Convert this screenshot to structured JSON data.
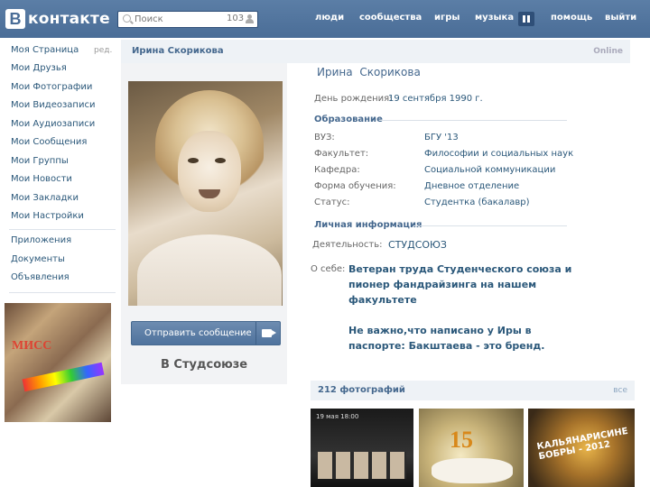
{
  "header": {
    "logo_letter": "В",
    "logo_text": "контакте",
    "search": {
      "placeholder": "Поиск",
      "count": "103"
    },
    "nav": [
      "люди",
      "сообщества",
      "игры",
      "музыка",
      "помощь",
      "выйти"
    ]
  },
  "sidebar": {
    "edit_label": "ред.",
    "items": [
      "Моя Страница",
      "Мои Друзья",
      "Мои Фотографии",
      "Мои Видеозаписи",
      "Мои Аудиозаписи",
      "Мои Сообщения",
      "Мои Группы",
      "Мои Новости",
      "Мои Закладки",
      "Мои Настройки"
    ],
    "apps": [
      "Приложения",
      "Документы",
      "Объявления"
    ],
    "ad_text": "МИСС"
  },
  "profile": {
    "header_name": "Ирина Скорикова",
    "online_status": "Online",
    "name": "Ирина  Скорикова",
    "birthday_label": "День рождения:",
    "birthday_value": "19 сентября 1990 г.",
    "education_head": "Образование",
    "education": [
      {
        "label": "ВУЗ:",
        "value": "БГУ '13"
      },
      {
        "label": "Факультет:",
        "value": "Философии и социальных наук"
      },
      {
        "label": "Кафедра:",
        "value": "Социальной коммуникации"
      },
      {
        "label": "Форма обучения:",
        "value": "Дневное отделение"
      },
      {
        "label": "Статус:",
        "value": "Студентка (бакалавр)"
      }
    ],
    "personal_head": "Личная информация",
    "activity_label": "Деятельность:",
    "activity_value": "СТУДСОЮЗ",
    "about_label": "О себе:",
    "about_p1": "Ветеран труда Студенческого союза и пионер фандрайзинга на нашем факультете",
    "about_p2": "Не важно,что написано у Иры в паспорте: Бакштаева - это бренд."
  },
  "actions": {
    "send_message": "Отправить сообщение",
    "group_label": "В Студсоюзе"
  },
  "photos": {
    "title": "212 фотографий",
    "all_label": "все",
    "thumb1_text": "19 мая 18:00",
    "thumb2_text": "15",
    "thumb3_text": "КАЛЬЯНАРИСИНЕ БОБРЫ - 2012"
  }
}
